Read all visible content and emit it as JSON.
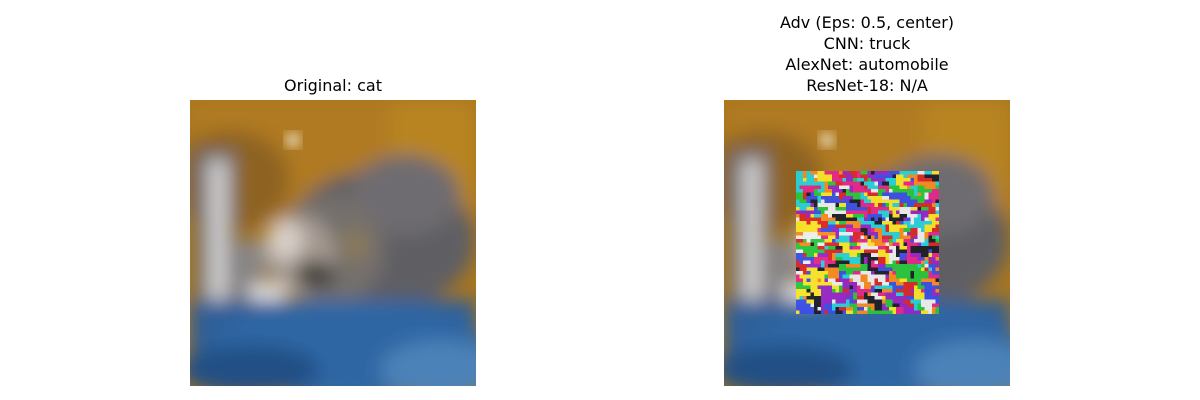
{
  "original_panel": {
    "title": "Original: cat"
  },
  "adversarial_panel": {
    "title_lines": [
      "Adv (Eps: 0.5, center)",
      "CNN: truck",
      "AlexNet: automobile",
      "ResNet-18: N/A"
    ]
  },
  "colors": {
    "background_orange": "#a8761f",
    "couch_blue": "#2e5f98",
    "cat_gray": "#6f6f72"
  }
}
